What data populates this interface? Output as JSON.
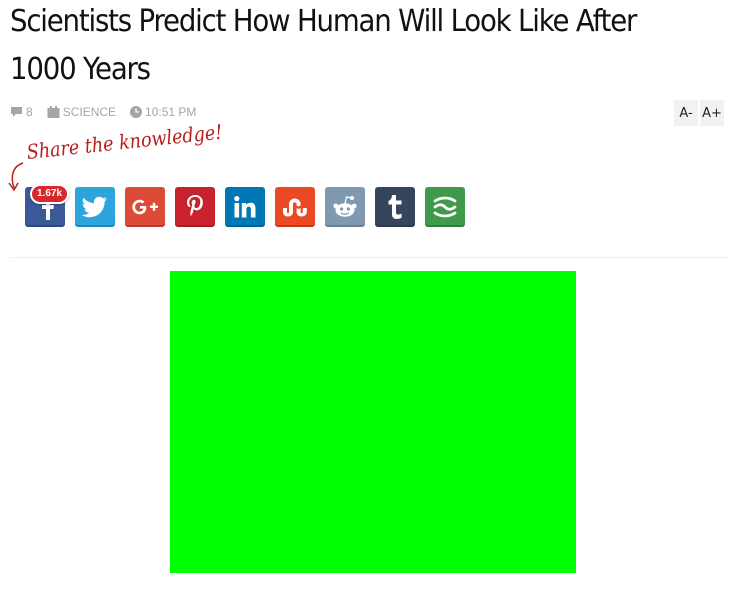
{
  "article": {
    "title": "Scientists Predict How Human Will Look Like After 1000 Years",
    "comment_count": "8",
    "category": "SCIENCE",
    "time": "10:51 PM"
  },
  "font_controls": {
    "decrease_label": "A-",
    "increase_label": "A+"
  },
  "share": {
    "tagline": "Share the knowledge!",
    "count_badge": "1.67k",
    "buttons": [
      {
        "network": "facebook",
        "icon": "facebook-icon",
        "color": "#3b5998"
      },
      {
        "network": "twitter",
        "icon": "twitter-icon",
        "color": "#2ca4dc"
      },
      {
        "network": "google-plus",
        "icon": "google-plus-icon",
        "color": "#dc4a38"
      },
      {
        "network": "pinterest",
        "icon": "pinterest-icon",
        "color": "#c8232c"
      },
      {
        "network": "linkedin",
        "icon": "linkedin-icon",
        "color": "#0077b5"
      },
      {
        "network": "stumbleupon",
        "icon": "stumbleupon-icon",
        "color": "#eb4924"
      },
      {
        "network": "reddit",
        "icon": "reddit-icon",
        "color": "#7f9ab0"
      },
      {
        "network": "tumblr",
        "icon": "tumblr-icon",
        "color": "#35465c"
      },
      {
        "network": "more",
        "icon": "more-share-icon",
        "color": "#3f9a4b"
      }
    ]
  },
  "featured_image": {
    "color": "#00ff00"
  },
  "colors": {
    "meta_text": "#a5a5a5",
    "tagline": "#b81c1c",
    "badge": "#d9272e"
  }
}
